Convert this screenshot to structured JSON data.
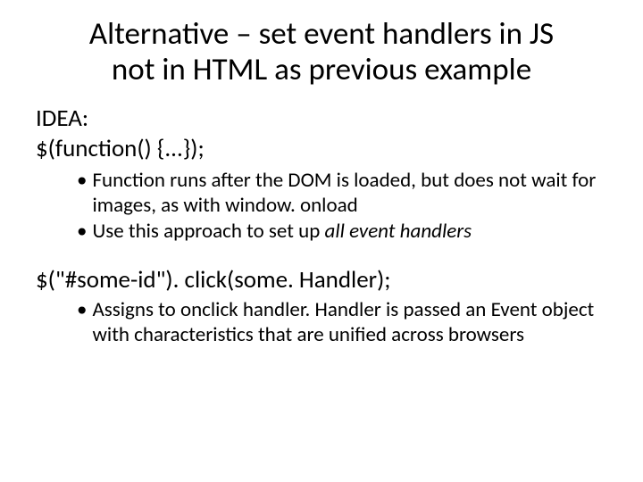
{
  "title_line1": "Alternative – set event handlers in JS",
  "title_line2": "not in HTML as previous example",
  "idea_label": "IDEA:",
  "idea_code": "$(function() {...});",
  "idea_bullets": [
    {
      "pre": "Function runs after the DOM is loaded, but does not wait for images, as with window. onload"
    },
    {
      "pre": "Use this approach to set up ",
      "em": "all event handlers"
    }
  ],
  "click_code": "$(\"#some-id\"). click(some. Handler);",
  "click_bullets": [
    {
      "pre": "Assigns to onclick handler. Handler is passed an Event object with characteristics that are unified across browsers"
    }
  ]
}
